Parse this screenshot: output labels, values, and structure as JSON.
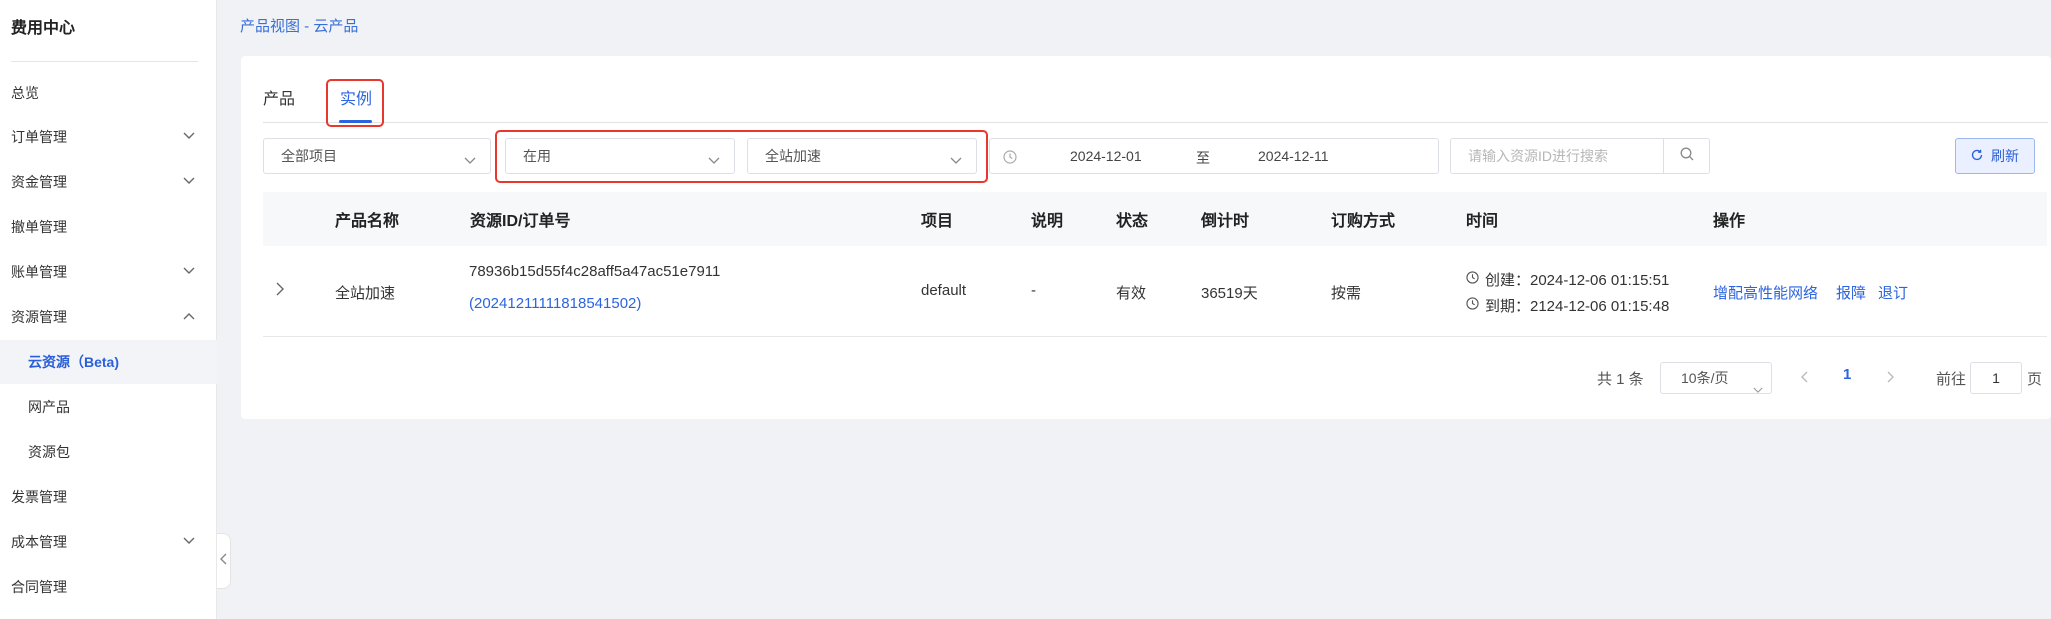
{
  "sidebar": {
    "title": "费用中心",
    "items": [
      {
        "label": "总览"
      },
      {
        "label": "订单管理"
      },
      {
        "label": "资金管理"
      },
      {
        "label": "撤单管理"
      },
      {
        "label": "账单管理"
      },
      {
        "label": "资源管理"
      },
      {
        "label": "云资源（Beta)"
      },
      {
        "label": "网产品"
      },
      {
        "label": "资源包"
      },
      {
        "label": "发票管理"
      },
      {
        "label": "成本管理"
      },
      {
        "label": "合同管理"
      }
    ]
  },
  "breadcrumb": "产品视图 - 云产品",
  "tabs": [
    {
      "label": "产品"
    },
    {
      "label": "实例"
    }
  ],
  "filters": {
    "project": "全部项目",
    "status": "在用",
    "product": "全站加速",
    "date_start": "2024-12-01",
    "date_separator": "至",
    "date_end": "2024-12-11",
    "search_placeholder": "请输入资源ID进行搜索",
    "refresh_label": "刷新"
  },
  "table": {
    "headers": [
      "产品名称",
      "资源ID/订单号",
      "项目",
      "说明",
      "状态",
      "倒计时",
      "订购方式",
      "时间",
      "操作"
    ],
    "rows": [
      {
        "product": "全站加速",
        "resource_id": "78936b15d55f4c28aff5a47ac51e7911",
        "order_id": "(20241211111818541502)",
        "project": "default",
        "description": "-",
        "status": "有效",
        "countdown": "36519天",
        "billing": "按需",
        "created": "创建：2024-12-06 01:15:51",
        "expires": "到期：2124-12-06 01:15:48",
        "actions": [
          "增配高性能网络",
          "报障",
          "退订"
        ]
      }
    ]
  },
  "pagination": {
    "total": "共 1 条",
    "page_size": "10条/页",
    "current": "1",
    "goto_label": "前往",
    "goto_value": "1",
    "page_label": "页"
  },
  "colors": {
    "accent": "#2b64df",
    "highlight_box": "#e8372c"
  }
}
